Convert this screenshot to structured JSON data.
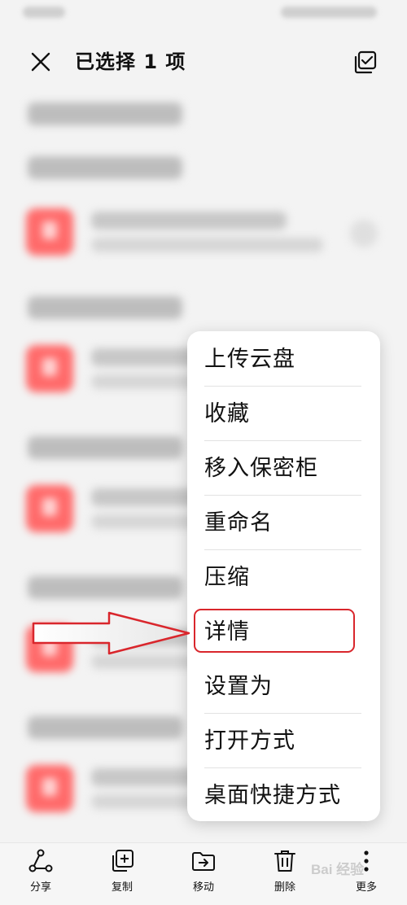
{
  "header": {
    "title": "已选择 1 项"
  },
  "context_menu": {
    "items": [
      {
        "label": "上传云盘"
      },
      {
        "label": "收藏"
      },
      {
        "label": "移入保密柜"
      },
      {
        "label": "重命名"
      },
      {
        "label": "压缩"
      },
      {
        "label": "详情"
      },
      {
        "label": "设置为"
      },
      {
        "label": "打开方式"
      },
      {
        "label": "桌面快捷方式"
      }
    ],
    "highlighted_item": "详情"
  },
  "toolbar": {
    "share_label": "分享",
    "copy_label": "复制",
    "move_label": "移动",
    "delete_label": "删除",
    "more_label": "更多"
  },
  "watermark": {
    "text": "Bai 经验"
  },
  "icons": {
    "close": "close-icon",
    "select_all": "select-all-icon",
    "share": "share-icon",
    "copy": "copy-icon",
    "move": "move-icon",
    "delete": "trash-icon",
    "more": "more-vertical-icon",
    "file": "audio-file-icon",
    "annotation": "arrow-right-icon"
  },
  "colors": {
    "highlight": "#d9262c",
    "file_icon": "#ff6a6a",
    "menu_bg": "#ffffff",
    "page_bg": "#f3f3f3"
  }
}
